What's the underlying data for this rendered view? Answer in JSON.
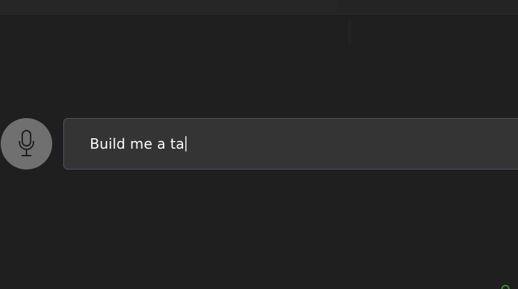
{
  "voice": {
    "icon": "microphone-icon"
  },
  "prompt": {
    "value": "Build me a ta"
  },
  "colors": {
    "background": "#1f1f1f",
    "input_background": "#343434",
    "input_border": "#55536a",
    "mic_circle": "#707070",
    "text": "#ffffff",
    "corner_accent": "#3f8f2f"
  }
}
